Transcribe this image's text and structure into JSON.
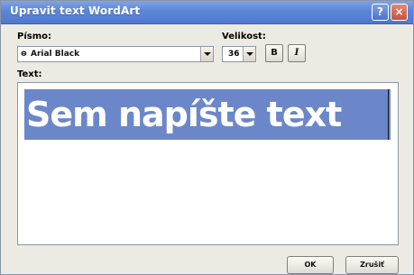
{
  "window": {
    "title": "Upravit text WordArt",
    "help_icon": "?",
    "close_icon": "×"
  },
  "font": {
    "label": "Písmo:",
    "value": "Arial Black",
    "icon": "ⱺ"
  },
  "size": {
    "label": "Velikost:",
    "value": "36"
  },
  "formatting": {
    "bold_label": "B",
    "italic_label": "I"
  },
  "text": {
    "label": "Text:",
    "value": "Sem napíšte text"
  },
  "buttons": {
    "ok": "OK",
    "cancel": "Zrušiť"
  },
  "colors": {
    "title_bar": "#5f87d7",
    "selection": "#6b87c9",
    "dialog_background": "#ecebe3"
  }
}
